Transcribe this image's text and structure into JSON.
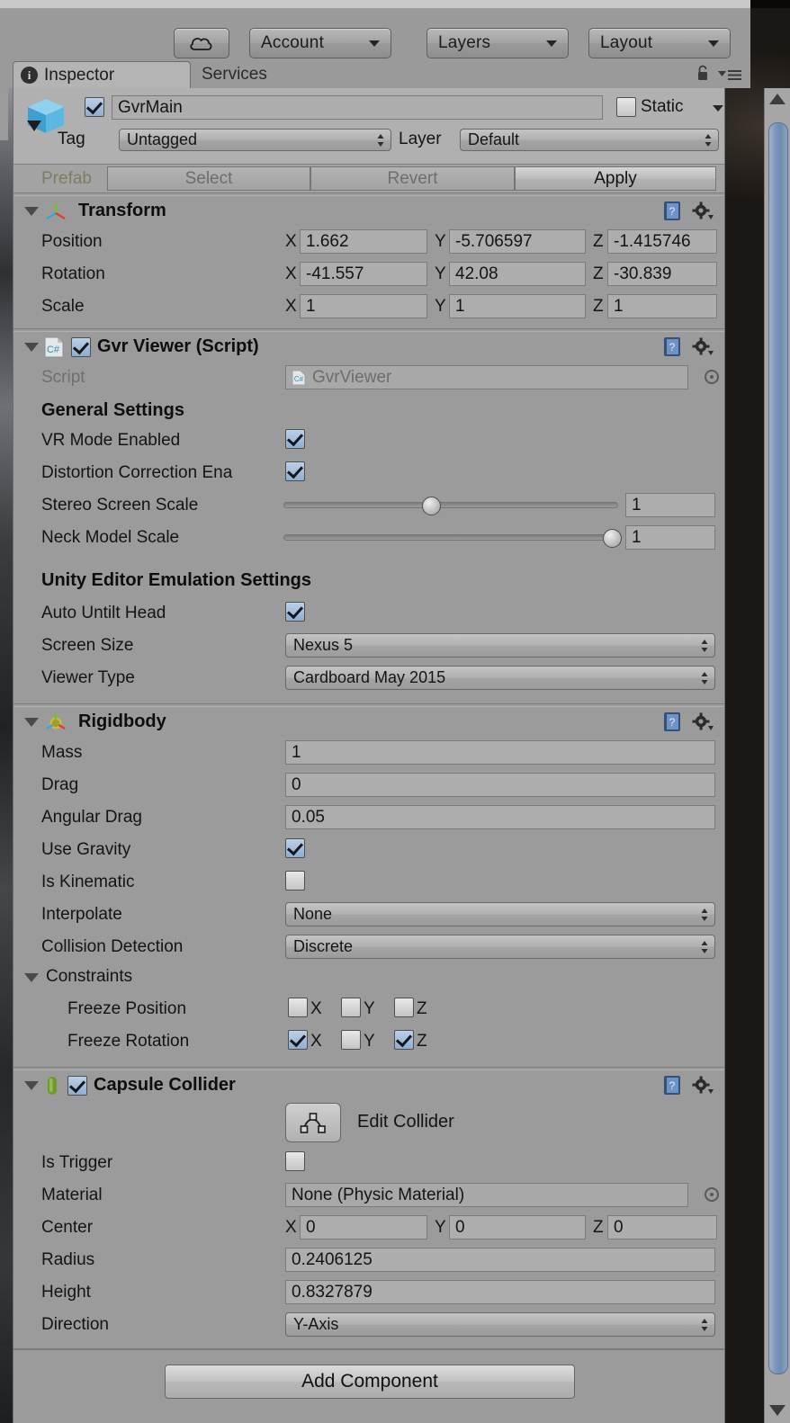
{
  "toolbar": {
    "cloud_icon": "cloud-icon",
    "account_label": "Account",
    "layers_label": "Layers",
    "layout_label": "Layout"
  },
  "tabs": {
    "inspector": "Inspector",
    "services": "Services",
    "lock_icon": "lock-icon",
    "menu_icon": "hamburger-menu-icon"
  },
  "gameobject": {
    "name": "GvrMain",
    "enabled": true,
    "static_label": "Static",
    "static_checked": false,
    "tag_label": "Tag",
    "tag_value": "Untagged",
    "layer_label": "Layer",
    "layer_value": "Default"
  },
  "prefab": {
    "label": "Prefab",
    "select": "Select",
    "revert": "Revert",
    "apply": "Apply"
  },
  "transform": {
    "title": "Transform",
    "icon": "transform-axis-icon",
    "position": {
      "label": "Position",
      "x": "1.662",
      "y": "-5.706597",
      "z": "-1.415746"
    },
    "rotation": {
      "label": "Rotation",
      "x": "-41.557",
      "y": "42.08",
      "z": "-30.839"
    },
    "scale": {
      "label": "Scale",
      "x": "1",
      "y": "1",
      "z": "1"
    },
    "axis_x": "X",
    "axis_y": "Y",
    "axis_z": "Z"
  },
  "gvrviewer": {
    "title": "Gvr Viewer (Script)",
    "icon": "csharp-script-icon",
    "enabled": true,
    "script_label": "Script",
    "script_value": "GvrViewer",
    "general_settings": "General Settings",
    "vr_mode_label": "VR Mode Enabled",
    "vr_mode_checked": true,
    "distortion_label": "Distortion Correction Ena",
    "distortion_checked": true,
    "stereo_label": "Stereo Screen Scale",
    "stereo_value": "1",
    "stereo_pct": 43,
    "neck_label": "Neck Model Scale",
    "neck_value": "1",
    "neck_pct": 96,
    "emulation_settings": "Unity Editor Emulation Settings",
    "auto_untilt_label": "Auto Untilt Head",
    "auto_untilt_checked": true,
    "screen_size_label": "Screen Size",
    "screen_size_value": "Nexus 5",
    "viewer_type_label": "Viewer Type",
    "viewer_type_value": "Cardboard May 2015"
  },
  "rigidbody": {
    "title": "Rigidbody",
    "icon": "rigidbody-icon",
    "mass_label": "Mass",
    "mass_value": "1",
    "drag_label": "Drag",
    "drag_value": "0",
    "angular_drag_label": "Angular Drag",
    "angular_drag_value": "0.05",
    "use_gravity_label": "Use Gravity",
    "use_gravity_checked": true,
    "is_kinematic_label": "Is Kinematic",
    "is_kinematic_checked": false,
    "interpolate_label": "Interpolate",
    "interpolate_value": "None",
    "collision_label": "Collision Detection",
    "collision_value": "Discrete",
    "constraints_label": "Constraints",
    "freeze_position_label": "Freeze Position",
    "freeze_position": {
      "x": false,
      "y": false,
      "z": false
    },
    "freeze_rotation_label": "Freeze Rotation",
    "freeze_rotation": {
      "x": true,
      "y": false,
      "z": true
    },
    "axis_x": "X",
    "axis_y": "Y",
    "axis_z": "Z"
  },
  "capsule": {
    "title": "Capsule Collider",
    "icon": "capsule-icon",
    "enabled": true,
    "edit_collider_label": "Edit Collider",
    "edit_collider_icon": "edit-collider-icon",
    "is_trigger_label": "Is Trigger",
    "is_trigger_checked": false,
    "material_label": "Material",
    "material_value": "None (Physic Material)",
    "center_label": "Center",
    "center_x": "0",
    "center_y": "0",
    "center_z": "0",
    "radius_label": "Radius",
    "radius_value": "0.2406125",
    "height_label": "Height",
    "height_value": "0.8327879",
    "direction_label": "Direction",
    "direction_value": "Y-Axis",
    "axis_x": "X",
    "axis_y": "Y",
    "axis_z": "Z"
  },
  "footer": {
    "add_component": "Add Component"
  },
  "scrollbar": {
    "up_icon": "scroll-up-arrow",
    "down_icon": "scroll-down-arrow"
  }
}
